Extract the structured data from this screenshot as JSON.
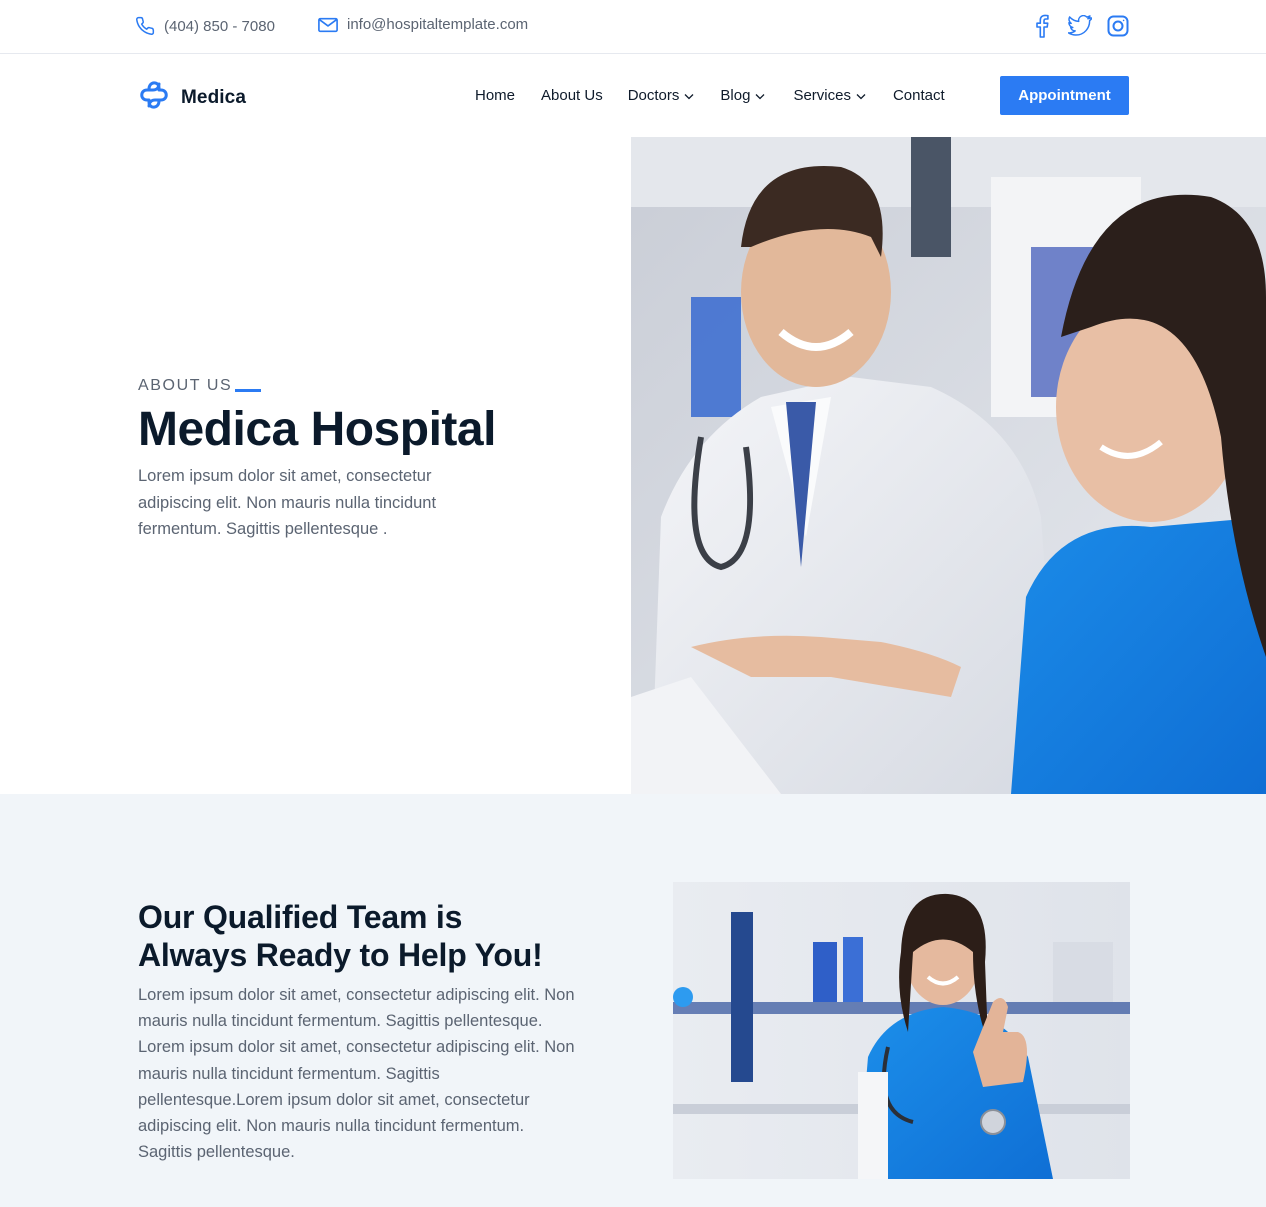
{
  "topbar": {
    "phone": {
      "icon": "phone-icon",
      "text": "(404) 850 - 7080"
    },
    "email": {
      "icon": "mail-icon",
      "text": "info@hospitaltemplate.com"
    },
    "social": [
      {
        "name": "facebook",
        "icon": "facebook-icon"
      },
      {
        "name": "twitter",
        "icon": "twitter-icon"
      },
      {
        "name": "instagram",
        "icon": "instagram-icon"
      }
    ]
  },
  "navbar": {
    "brand": "Medica",
    "logo_icon": "medical-cross-logo-icon",
    "items": [
      {
        "label": "Home",
        "dropdown": false
      },
      {
        "label": "About Us",
        "dropdown": false
      },
      {
        "label": "Doctors",
        "dropdown": true
      },
      {
        "label": "Blog",
        "dropdown": true
      },
      {
        "label": "Services",
        "dropdown": true
      },
      {
        "label": "Contact",
        "dropdown": false
      }
    ],
    "cta": "Appointment"
  },
  "hero": {
    "eyebrow": "ABOUT US",
    "title": "Medica Hospital",
    "description": "Lorem ipsum dolor sit amet, consectetur adipiscing elit. Non mauris nulla tincidunt fermentum. Sagittis pellentesque .",
    "image_alt": "Smiling doctor in white coat and nurse in blue scrubs reviewing a document"
  },
  "team": {
    "title": "Our Qualified Team is Always Ready to Help You!",
    "description": "Lorem ipsum dolor sit amet, consectetur adipiscing elit. Non mauris nulla tincidunt fermentum. Sagittis pellentesque. Lorem ipsum dolor sit amet, consectetur adipiscing elit. Non mauris nulla tincidunt fermentum. Sagittis pellentesque.Lorem ipsum dolor sit amet, consectetur adipiscing elit. Non mauris nulla tincidunt fermentum. Sagittis pellentesque.",
    "image_alt": "Smiling nurse in blue scrubs giving a thumbs up"
  },
  "colors": {
    "accent": "#2b7bf3",
    "heading": "#0b1a2b",
    "body_text": "#5b6472",
    "section_bg": "#f1f5f9"
  }
}
